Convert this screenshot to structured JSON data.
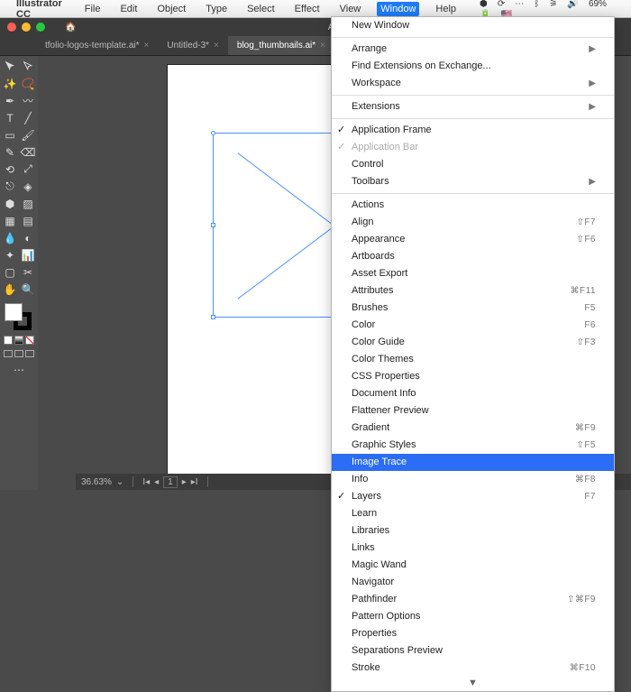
{
  "menubar": {
    "app": "Illustrator CC",
    "items": [
      "File",
      "Edit",
      "Object",
      "Type",
      "Select",
      "Effect",
      "View",
      "Window",
      "Help"
    ],
    "active_index": 7,
    "status": {
      "battery": "69%",
      "flag": "🇺🇸"
    }
  },
  "window": {
    "title": "Adobe Ill…",
    "home_icon": "home-icon"
  },
  "tabs": [
    {
      "label": "tfolio-logos-template.ai*",
      "active": false
    },
    {
      "label": "Untitled-3*",
      "active": false
    },
    {
      "label": "blog_thumbnails.ai*",
      "active": true
    }
  ],
  "canvas": {
    "zoom": "36.63%",
    "artboard_nav": {
      "current": "1"
    },
    "mode": "Selection"
  },
  "dropdown": {
    "groups": [
      [
        {
          "label": "New Window"
        }
      ],
      [
        {
          "label": "Arrange",
          "submenu": true
        },
        {
          "label": "Find Extensions on Exchange..."
        },
        {
          "label": "Workspace",
          "submenu": true
        }
      ],
      [
        {
          "label": "Extensions",
          "submenu": true
        }
      ],
      [
        {
          "label": "Application Frame",
          "checked": true
        },
        {
          "label": "Application Bar",
          "checked": true,
          "disabled": true
        },
        {
          "label": "Control"
        },
        {
          "label": "Toolbars",
          "submenu": true
        }
      ],
      [
        {
          "label": "Actions"
        },
        {
          "label": "Align",
          "shortcut": "⇧F7"
        },
        {
          "label": "Appearance",
          "shortcut": "⇧F6"
        },
        {
          "label": "Artboards"
        },
        {
          "label": "Asset Export"
        },
        {
          "label": "Attributes",
          "shortcut": "⌘F11"
        },
        {
          "label": "Brushes",
          "shortcut": "F5"
        },
        {
          "label": "Color",
          "shortcut": "F6"
        },
        {
          "label": "Color Guide",
          "shortcut": "⇧F3"
        },
        {
          "label": "Color Themes"
        },
        {
          "label": "CSS Properties"
        },
        {
          "label": "Document Info"
        },
        {
          "label": "Flattener Preview"
        },
        {
          "label": "Gradient",
          "shortcut": "⌘F9"
        },
        {
          "label": "Graphic Styles",
          "shortcut": "⇧F5"
        },
        {
          "label": "Image Trace",
          "selected": true
        },
        {
          "label": "Info",
          "shortcut": "⌘F8"
        },
        {
          "label": "Layers",
          "checked": true,
          "shortcut": "F7"
        },
        {
          "label": "Learn"
        },
        {
          "label": "Libraries"
        },
        {
          "label": "Links"
        },
        {
          "label": "Magic Wand"
        },
        {
          "label": "Navigator"
        },
        {
          "label": "Pathfinder",
          "shortcut": "⇧⌘F9"
        },
        {
          "label": "Pattern Options"
        },
        {
          "label": "Properties"
        },
        {
          "label": "Separations Preview"
        },
        {
          "label": "Stroke",
          "shortcut": "⌘F10"
        }
      ]
    ]
  }
}
